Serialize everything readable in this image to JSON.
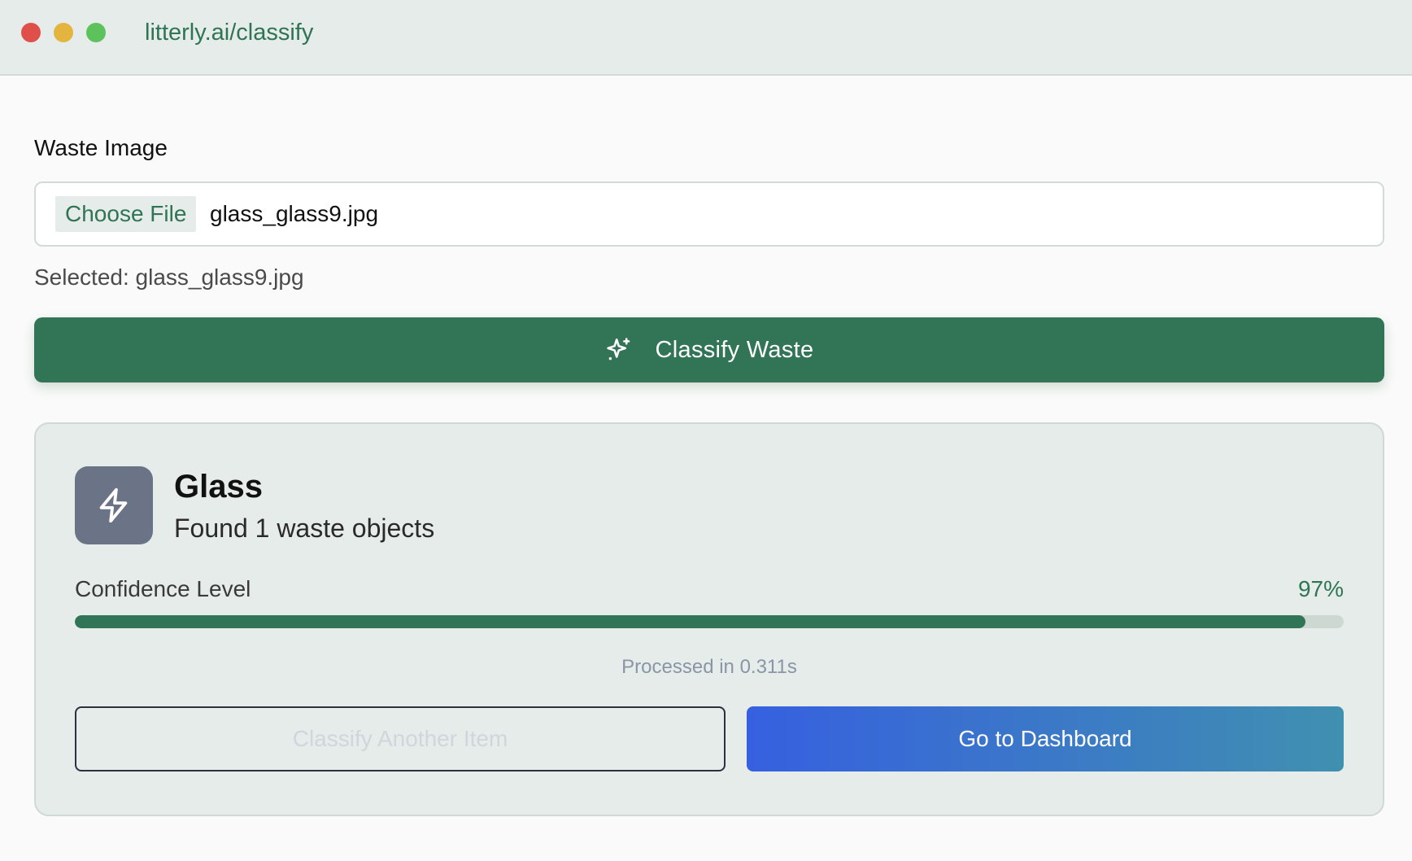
{
  "window": {
    "url": "litterly.ai/classify"
  },
  "form": {
    "field_label": "Waste Image",
    "choose_file_label": "Choose File",
    "file_name": "glass_glass9.jpg",
    "selected_text": "Selected: glass_glass9.jpg",
    "classify_button_label": "Classify Waste",
    "classify_icon": "sparkles-icon"
  },
  "result": {
    "category": "Glass",
    "category_icon": "lightning-bolt-icon",
    "summary": "Found 1 waste objects",
    "confidence_label": "Confidence Level",
    "confidence_value": "97%",
    "confidence_fraction": 0.97,
    "processed_text": "Processed in 0.311s",
    "classify_another_label": "Classify Another Item",
    "dashboard_label": "Go to Dashboard"
  },
  "colors": {
    "brand_green": "#327556",
    "icon_tile": "#6b7386",
    "primary_gradient_start": "#3660e0",
    "primary_gradient_end": "#4090b0"
  }
}
